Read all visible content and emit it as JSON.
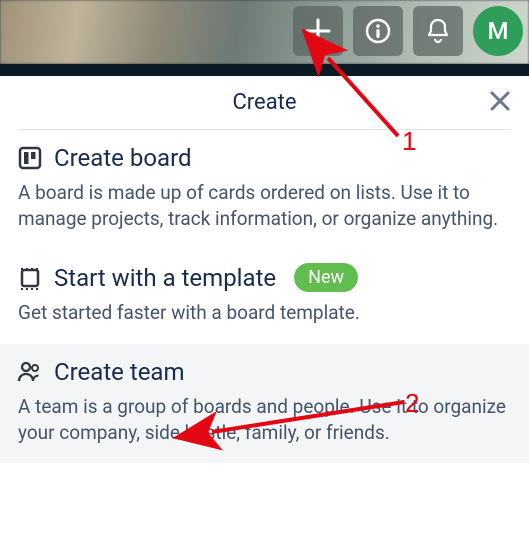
{
  "header": {
    "avatar_initial": "M"
  },
  "popover": {
    "title": "Create",
    "sections": [
      {
        "title": "Create board",
        "desc": "A board is made up of cards ordered on lists. Use it to manage projects, track information, or organize anything."
      },
      {
        "title": "Start with a template",
        "badge": "New",
        "desc": "Get started faster with a board template."
      },
      {
        "title": "Create team",
        "desc": "A team is a group of boards and people. Use it to organize your company, side hustle, family, or friends."
      }
    ]
  },
  "annotations": {
    "label1": "1",
    "label2": "2"
  }
}
